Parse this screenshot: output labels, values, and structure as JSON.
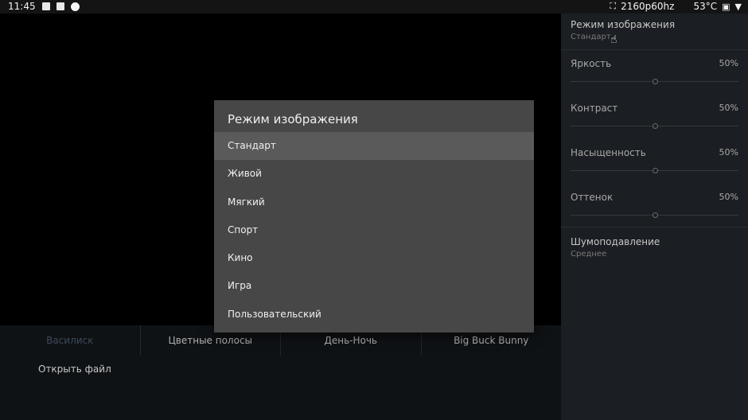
{
  "status_bar": {
    "time": "11:45",
    "left_icons": [
      "image-icon",
      "a-badge-icon",
      "circle-icon"
    ],
    "resolution": "2160p60hz",
    "temperature": "53°C",
    "right_icons": [
      "screen-icon",
      "thermometer-icon",
      "wifi-icon"
    ]
  },
  "bottom_bar": {
    "tabs": [
      "Василиск",
      "Цветные полосы",
      "День-Ночь",
      "Big Buck Bunny"
    ],
    "active_tab": 0,
    "open_file": "Открыть файл"
  },
  "settings_panel": {
    "picture_mode": {
      "title": "Режим изображения",
      "value": "Стандарт"
    },
    "sliders": [
      {
        "label": "Яркость",
        "value": "50%",
        "level": 0.5
      },
      {
        "label": "Контраст",
        "value": "50%",
        "level": 0.5
      },
      {
        "label": "Насыщенность",
        "value": "50%",
        "level": 0.5
      },
      {
        "label": "Оттенок",
        "value": "50%",
        "level": 0.5
      }
    ],
    "noise_reduction": {
      "title": "Шумоподавление",
      "value": "Среднее"
    }
  },
  "dialog": {
    "title": "Режим изображения",
    "options": [
      "Стандарт",
      "Живой",
      "Мягкий",
      "Спорт",
      "Кино",
      "Игра",
      "Пользовательский"
    ],
    "selected": 0
  },
  "colors": {
    "background": "#0b0e11",
    "panel": "#1b1e22",
    "dialog": "#474747",
    "dialog_selected": "#5a5a5a"
  }
}
